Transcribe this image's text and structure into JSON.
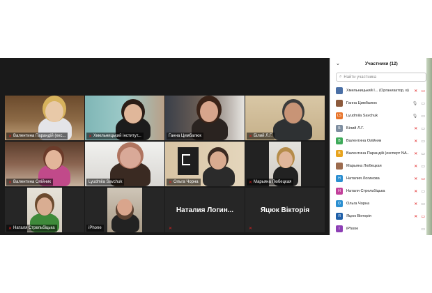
{
  "participants_panel": {
    "title": "Участники (12)",
    "search_placeholder": "Найти участника",
    "participants": [
      {
        "name": "Хмельницький І... (Организатор, в)",
        "avatar_letter": "",
        "avatar_color": "#4a6fa5",
        "mic": "off",
        "cam": "off"
      },
      {
        "name": "Ганна Цимбалюк",
        "avatar_letter": "",
        "avatar_color": "#8c5a3c",
        "mic": "on",
        "cam": "on"
      },
      {
        "name": "Lyudmila Savchuk",
        "avatar_letter": "LS",
        "avatar_color": "#e8742a",
        "mic": "on",
        "cam": "on"
      },
      {
        "name": "Білий Л.Г.",
        "avatar_letter": "Б",
        "avatar_color": "#7e8ea0",
        "mic": "off",
        "cam": "on"
      },
      {
        "name": "Валентина Олійник",
        "avatar_letter": "В",
        "avatar_color": "#3eaa5a",
        "mic": "off",
        "cam": "on"
      },
      {
        "name": "Валентина Парандій (експерт NA...",
        "avatar_letter": "В",
        "avatar_color": "#e8a41f",
        "mic": "off",
        "cam": "on"
      },
      {
        "name": "Марьяна Любецкая",
        "avatar_letter": "",
        "avatar_color": "#9c6b4e",
        "mic": "off",
        "cam": "on"
      },
      {
        "name": "Наталия Логинова",
        "avatar_letter": "Н",
        "avatar_color": "#2b8fd1",
        "mic": "off",
        "cam": "off"
      },
      {
        "name": "Наталя Стрельбіцька",
        "avatar_letter": "Н",
        "avatar_color": "#c2409a",
        "mic": "off",
        "cam": "on"
      },
      {
        "name": "Ольга Чорна",
        "avatar_letter": "О",
        "avatar_color": "#2b8fd1",
        "mic": "off",
        "cam": "on"
      },
      {
        "name": "Яцюк Вікторія",
        "avatar_letter": "Я",
        "avatar_color": "#1f5fa8",
        "mic": "off",
        "cam": "off"
      },
      {
        "name": "iPhone",
        "avatar_letter": "I",
        "avatar_color": "#8d3fb5",
        "mic": "",
        "cam": "on"
      }
    ]
  },
  "tiles": [
    {
      "name": "Валентина Парандій (екс...",
      "mic_off": true
    },
    {
      "name": "Хмельницький інститут...",
      "mic_off": true
    },
    {
      "name": "Ганна Цимбалюк",
      "mic_off": false
    },
    {
      "name": "Білий Л.Г.",
      "mic_off": true
    },
    {
      "name": "Валентина Олійник",
      "mic_off": true
    },
    {
      "name": "Lyudmila Savchuk",
      "mic_off": false
    },
    {
      "name": "Ольга Чорна",
      "mic_off": true
    },
    {
      "name": "Марьяна Любецкая",
      "mic_off": true
    },
    {
      "name": "Наталя Стрельбіцька",
      "mic_off": true
    },
    {
      "name": "iPhone",
      "mic_off": false
    },
    {
      "name": "",
      "display": "Наталия Логин...",
      "mic_off": true
    },
    {
      "name": "",
      "display": "Яцюк Вікторія",
      "mic_off": true
    }
  ]
}
